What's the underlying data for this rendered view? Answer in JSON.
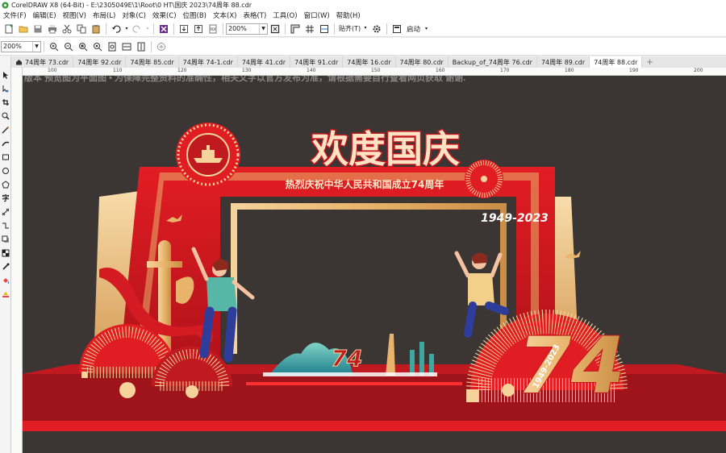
{
  "window": {
    "title": "CorelDRAW X8 (64-Bit) - E:\\2305049E\\1\\Root\\0 HT\\国庆 2023\\74周年 88.cdr"
  },
  "menu": [
    "文件(F)",
    "编辑(E)",
    "视图(V)",
    "布局(L)",
    "对象(C)",
    "效果(C)",
    "位图(B)",
    "文本(X)",
    "表格(T)",
    "工具(O)",
    "窗口(W)",
    "帮助(H)"
  ],
  "toolbar": {
    "zoom_value": "200%",
    "snap_label": "贴齐(T)",
    "launch_label": "启动"
  },
  "property_bar": {
    "zoom_value": "200%"
  },
  "tabs": [
    {
      "label": "74周年 73.cdr",
      "active": false
    },
    {
      "label": "74周年 92.cdr",
      "active": false
    },
    {
      "label": "74周年 85.cdr",
      "active": false
    },
    {
      "label": "74周年 74-1.cdr",
      "active": false
    },
    {
      "label": "74周年 41.cdr",
      "active": false
    },
    {
      "label": "74周年 91.cdr",
      "active": false
    },
    {
      "label": "74周年 16.cdr",
      "active": false
    },
    {
      "label": "74周年 80.cdr",
      "active": false
    },
    {
      "label": "Backup_of_74周年 76.cdr",
      "active": false
    },
    {
      "label": "74周年 89.cdr",
      "active": false
    },
    {
      "label": "74周年 88.cdr",
      "active": true
    }
  ],
  "ruler": {
    "labels": [
      "100",
      "110",
      "120",
      "130",
      "140",
      "150",
      "160",
      "170",
      "180",
      "190",
      "200"
    ]
  },
  "canvas": {
    "note": "版本   预览图为平面图  • 为保障完整资料的准确性，相关文字以官方发布为准，请根据需要自行查看网页获取 谢谢.",
    "headline": "欢度国庆",
    "subtitle": "热烈庆祝中华人民共和国成立74周年",
    "years": "1949-2023",
    "big_number": "74",
    "small_number": "74",
    "diag_years": "1949-2023"
  },
  "colors": {
    "canvas_bg": "#3b3534",
    "red": "#c4141c",
    "dark_red": "#8f0f13",
    "gold": "#e8b36a"
  }
}
